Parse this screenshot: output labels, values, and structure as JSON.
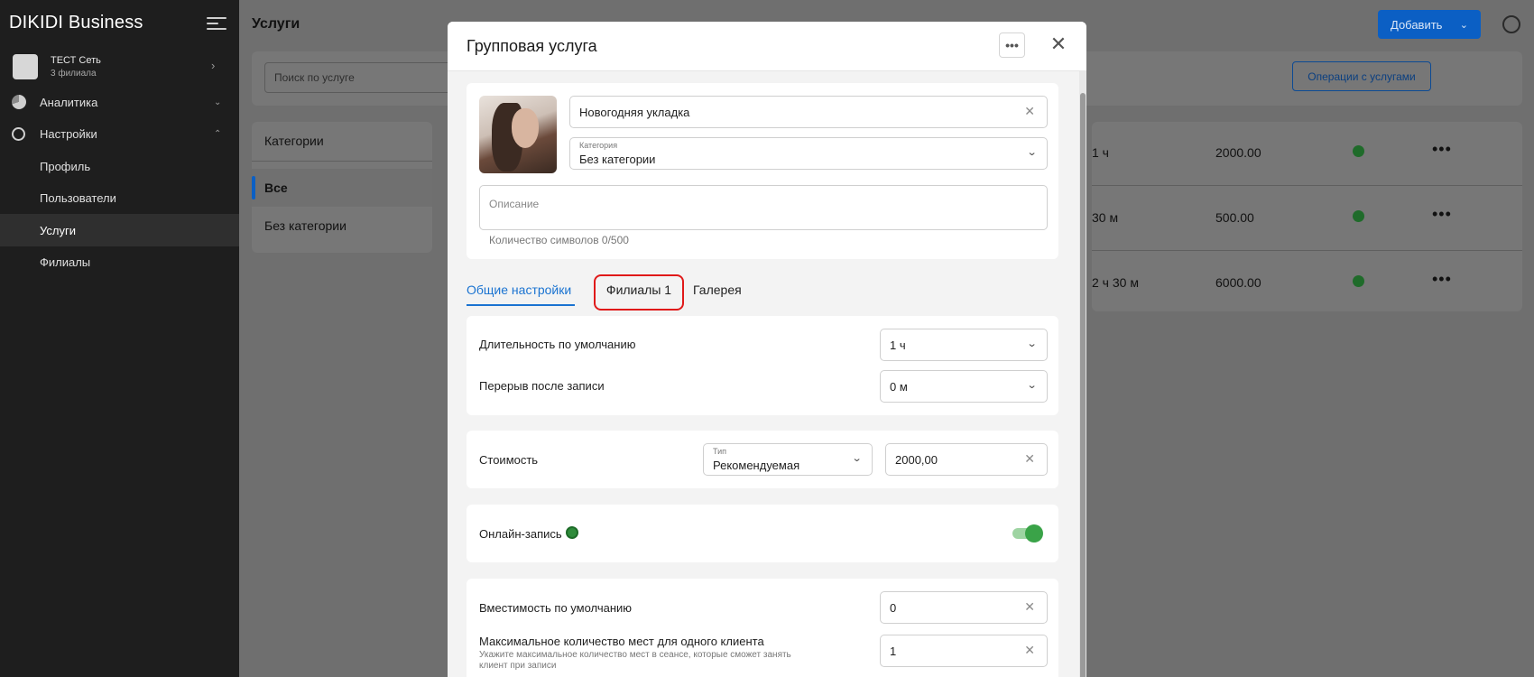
{
  "sidebar": {
    "brand": "DIKIDI Business",
    "org": {
      "name": "ТЕСТ Сеть",
      "sub": "3 филиала"
    },
    "items": [
      {
        "label": "Аналитика"
      },
      {
        "label": "Настройки"
      },
      {
        "label": "Профиль"
      },
      {
        "label": "Пользователи"
      },
      {
        "label": "Услуги"
      },
      {
        "label": "Филиалы"
      }
    ]
  },
  "main": {
    "title": "Услуги",
    "add_label": "Добавить",
    "search_placeholder": "Поиск по услуге",
    "ops_label": "Операции с услугами",
    "categories_title": "Категории",
    "categories": [
      "Все",
      "Без категории"
    ],
    "rows": [
      {
        "duration": "1 ч",
        "price": "2000.00"
      },
      {
        "duration": "30 м",
        "price": "500.00"
      },
      {
        "duration": "2 ч 30 м",
        "price": "6000.00"
      }
    ]
  },
  "modal": {
    "title": "Групповая услуга",
    "name_value": "Новогодняя укладка",
    "category_label": "Категория",
    "category_value": "Без категории",
    "description_placeholder": "Описание",
    "char_counter": "Количество символов 0/500",
    "tabs": [
      "Общие настройки",
      "Филиалы 1",
      "Галерея"
    ],
    "default_duration_label": "Длительность по умолчанию",
    "default_duration_value": "1 ч",
    "break_label": "Перерыв после записи",
    "break_value": "0 м",
    "price_label": "Стоимость",
    "price_type_label": "Тип",
    "price_type_value": "Рекомендуемая",
    "price_value": "2000,00",
    "online_label": "Онлайн-запись",
    "online_enabled": true,
    "capacity_label": "Вместимость по умолчанию",
    "capacity_value": "0",
    "max_places_label": "Максимальное количество мест для одного клиента",
    "max_places_hint": "Укажите максимальное количество мест в сеансе, которые сможет занять клиент при записи",
    "max_places_value": "1"
  },
  "colors": {
    "accent": "#1a73d1",
    "highlight": "#e01919",
    "toggle_on": "#3aa348"
  }
}
